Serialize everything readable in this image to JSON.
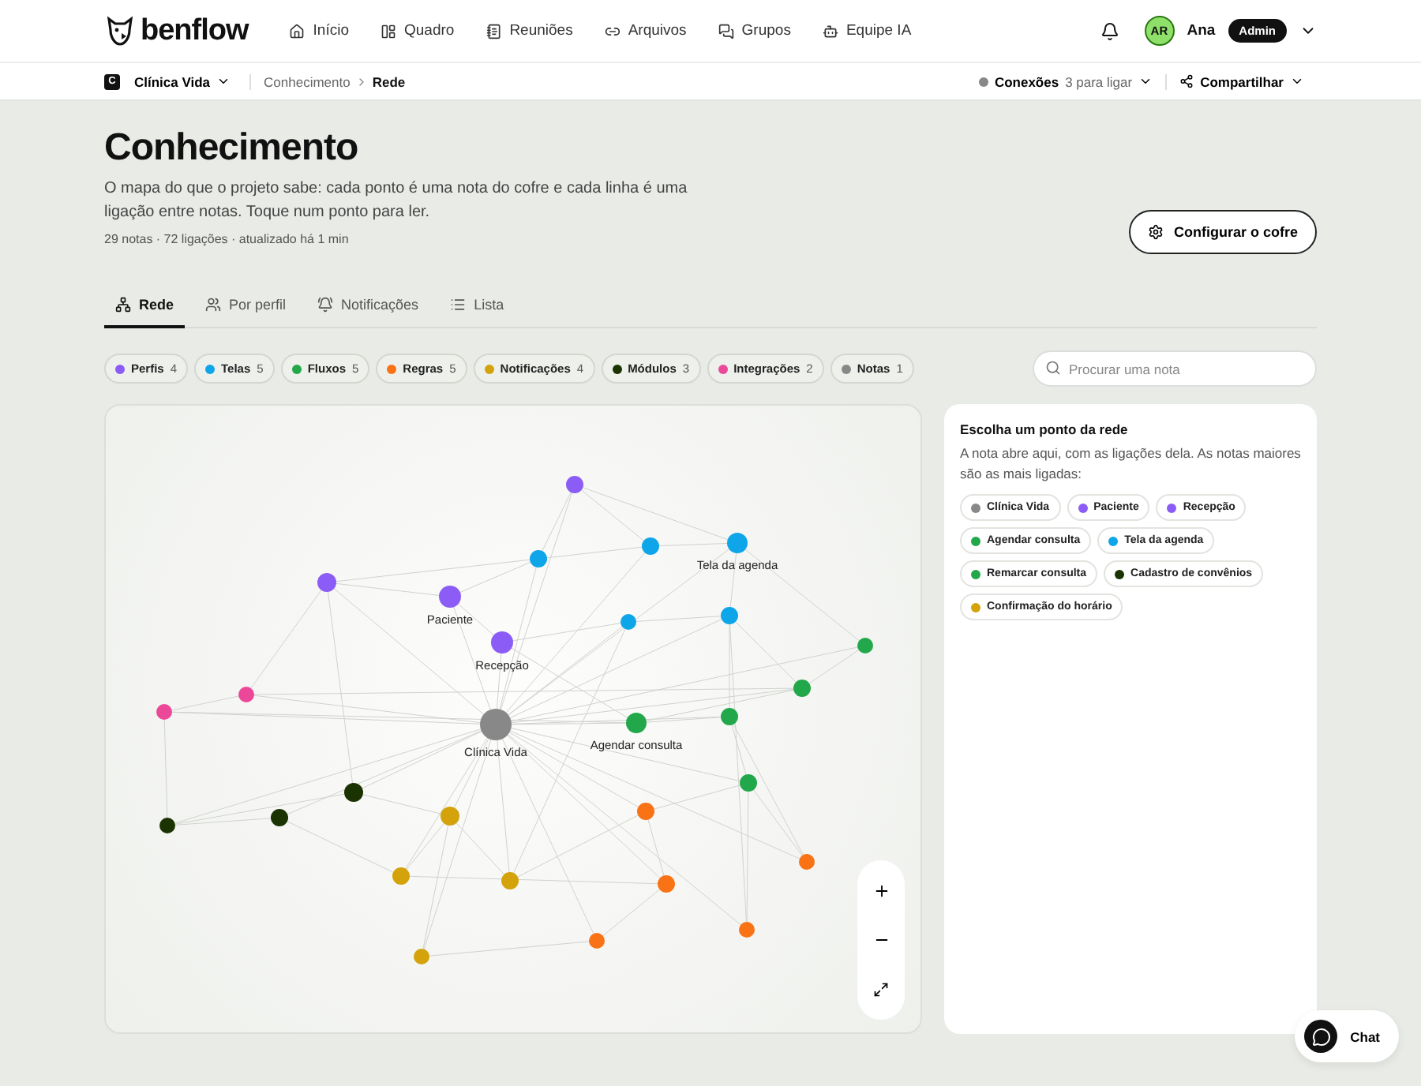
{
  "brand": {
    "name": "benflow"
  },
  "nav": [
    {
      "label": "Início"
    },
    {
      "label": "Quadro"
    },
    {
      "label": "Reuniões"
    },
    {
      "label": "Arquivos"
    },
    {
      "label": "Grupos"
    },
    {
      "label": "Equipe IA"
    }
  ],
  "user": {
    "initials": "AR",
    "name": "Ana",
    "role": "Admin"
  },
  "subbar": {
    "workspace_badge": "C",
    "workspace": "Clínica Vida",
    "breadcrumb": [
      "Conhecimento",
      "Rede"
    ],
    "connections_label": "Conexões",
    "connections_value": "3 para ligar",
    "share": "Compartilhar"
  },
  "page": {
    "title": "Conhecimento",
    "description": "O mapa do que o projeto sabe: cada ponto é uma nota do cofre e cada linha é uma ligação entre notas. Toque num ponto para ler.",
    "meta": "29 notas · 72 ligações · atualizado há 1 min",
    "config_button": "Configurar o cofre"
  },
  "tabs": [
    {
      "label": "Rede",
      "selected": true
    },
    {
      "label": "Por perfil",
      "selected": false
    },
    {
      "label": "Notificações",
      "selected": false
    },
    {
      "label": "Lista",
      "selected": false
    }
  ],
  "filters": [
    {
      "label": "Perfis",
      "count": "4",
      "color": "#8b5cf6"
    },
    {
      "label": "Telas",
      "count": "5",
      "color": "#0ea5e9"
    },
    {
      "label": "Fluxos",
      "count": "5",
      "color": "#22a84a"
    },
    {
      "label": "Regras",
      "count": "5",
      "color": "#f97316"
    },
    {
      "label": "Notificações",
      "count": "4",
      "color": "#d4a20a"
    },
    {
      "label": "Módulos",
      "count": "3",
      "color": "#1a3300"
    },
    {
      "label": "Integrações",
      "count": "2",
      "color": "#ec4899"
    },
    {
      "label": "Notas",
      "count": "1",
      "color": "#888888"
    }
  ],
  "search": {
    "placeholder": "Procurar uma nota"
  },
  "graph": {
    "nodes": [
      {
        "label": "Clínica Vida",
        "color": "#888888"
      },
      {
        "label": "Paciente",
        "color": "#8b5cf6"
      },
      {
        "label": "Recepção",
        "color": "#8b5cf6"
      },
      {
        "label": "Tela da agenda",
        "color": "#0ea5e9"
      },
      {
        "label": "Agendar consulta",
        "color": "#22a84a"
      },
      {
        "color": "#8b5cf6"
      },
      {
        "color": "#8b5cf6"
      },
      {
        "color": "#0ea5e9"
      },
      {
        "color": "#0ea5e9"
      },
      {
        "color": "#0ea5e9"
      },
      {
        "color": "#0ea5e9"
      },
      {
        "color": "#22a84a"
      },
      {
        "color": "#22a84a"
      },
      {
        "color": "#22a84a"
      },
      {
        "color": "#22a84a"
      },
      {
        "color": "#ec4899"
      },
      {
        "color": "#ec4899"
      },
      {
        "color": "#1a3300"
      },
      {
        "color": "#1a3300"
      },
      {
        "color": "#1a3300"
      },
      {
        "color": "#d4a20a"
      },
      {
        "color": "#d4a20a"
      },
      {
        "color": "#d4a20a"
      },
      {
        "color": "#d4a20a"
      },
      {
        "color": "#f97316"
      },
      {
        "color": "#f97316"
      },
      {
        "color": "#f97316"
      },
      {
        "color": "#f97316"
      },
      {
        "color": "#f97316"
      }
    ]
  },
  "panel": {
    "title": "Escolha um ponto da rede",
    "text": "A nota abre aqui, com as ligações dela. As notas maiores são as mais ligadas:",
    "chips": [
      {
        "label": "Clínica Vida",
        "color": "#888888"
      },
      {
        "label": "Paciente",
        "color": "#8b5cf6"
      },
      {
        "label": "Recepção",
        "color": "#8b5cf6"
      },
      {
        "label": "Agendar consulta",
        "color": "#22a84a"
      },
      {
        "label": "Tela da agenda",
        "color": "#0ea5e9"
      },
      {
        "label": "Remarcar consulta",
        "color": "#22a84a"
      },
      {
        "label": "Cadastro de convênios",
        "color": "#1a3300"
      },
      {
        "label": "Confirmação do horário",
        "color": "#d4a20a"
      }
    ]
  },
  "chat": {
    "label": "Chat"
  }
}
